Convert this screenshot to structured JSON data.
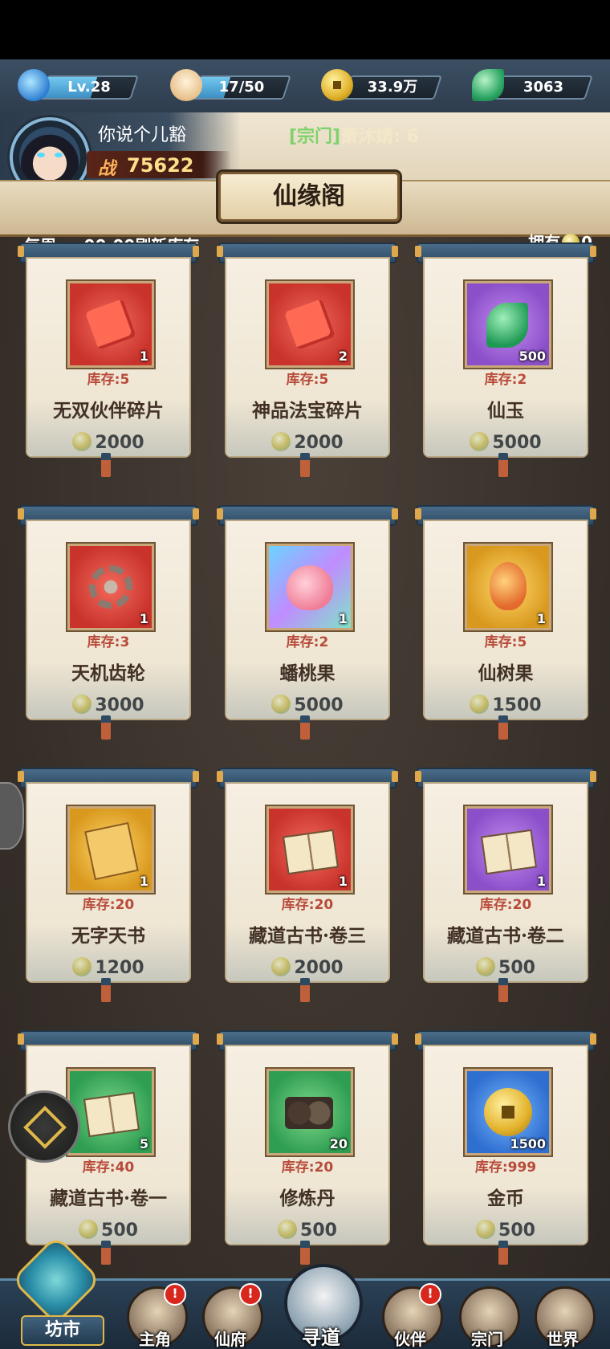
{
  "resources": [
    {
      "icon": "dragon-icon",
      "value": "Lv.28",
      "fill": 0.55
    },
    {
      "icon": "bun-icon",
      "value": "17/50",
      "fill": 0.34
    },
    {
      "icon": "copper-coin-icon",
      "value": "33.9万"
    },
    {
      "icon": "jade-leaf-icon",
      "value": "3063"
    }
  ],
  "player": {
    "name": "你说个儿豁",
    "power_label": "战",
    "power_value": "75622",
    "sect_tag": "[宗门]",
    "sect_text": "萧沐婧: 6"
  },
  "shop": {
    "title": "仙缘阁",
    "refresh_text": "每周一, 00:00刷新库存",
    "owned_label": "拥有",
    "owned_value": "0"
  },
  "items": [
    {
      "name": "无双伙伴碎片",
      "count": "1",
      "stock": "库存:5",
      "price": "2000",
      "bg": "red",
      "art": "puzzle"
    },
    {
      "name": "神品法宝碎片",
      "count": "2",
      "stock": "库存:5",
      "price": "2000",
      "bg": "red",
      "art": "puzzle"
    },
    {
      "name": "仙玉",
      "count": "500",
      "stock": "库存:2",
      "price": "5000",
      "bg": "purple",
      "art": "gem-leaf"
    },
    {
      "name": "天机齿轮",
      "count": "1",
      "stock": "库存:3",
      "price": "3000",
      "bg": "red",
      "art": "gear"
    },
    {
      "name": "蟠桃果",
      "count": "1",
      "stock": "库存:2",
      "price": "5000",
      "bg": "rainbow",
      "art": "peach"
    },
    {
      "name": "仙树果",
      "count": "1",
      "stock": "库存:5",
      "price": "1500",
      "bg": "gold",
      "art": "seed"
    },
    {
      "name": "无字天书",
      "count": "1",
      "stock": "库存:20",
      "price": "1200",
      "bg": "gold",
      "art": "book-y"
    },
    {
      "name": "藏道古书·卷三",
      "count": "1",
      "stock": "库存:20",
      "price": "2000",
      "bg": "red",
      "art": "book"
    },
    {
      "name": "藏道古书·卷二",
      "count": "1",
      "stock": "库存:20",
      "price": "500",
      "bg": "purple",
      "art": "book"
    },
    {
      "name": "藏道古书·卷一",
      "count": "5",
      "stock": "库存:40",
      "price": "500",
      "bg": "green",
      "art": "book"
    },
    {
      "name": "修炼丹",
      "count": "20",
      "stock": "库存:20",
      "price": "500",
      "bg": "green",
      "art": "pills"
    },
    {
      "name": "金币",
      "count": "1500",
      "stock": "库存:999",
      "price": "500",
      "bg": "blue",
      "art": "bigcoin"
    }
  ],
  "nav": {
    "home": "坊市",
    "items": [
      {
        "label": "主角",
        "badge": "!"
      },
      {
        "label": "仙府",
        "badge": "!"
      },
      {
        "label": "寻道",
        "badge": ""
      },
      {
        "label": "伙伴",
        "badge": "!"
      },
      {
        "label": "宗门",
        "badge": ""
      },
      {
        "label": "世界",
        "badge": ""
      }
    ]
  }
}
